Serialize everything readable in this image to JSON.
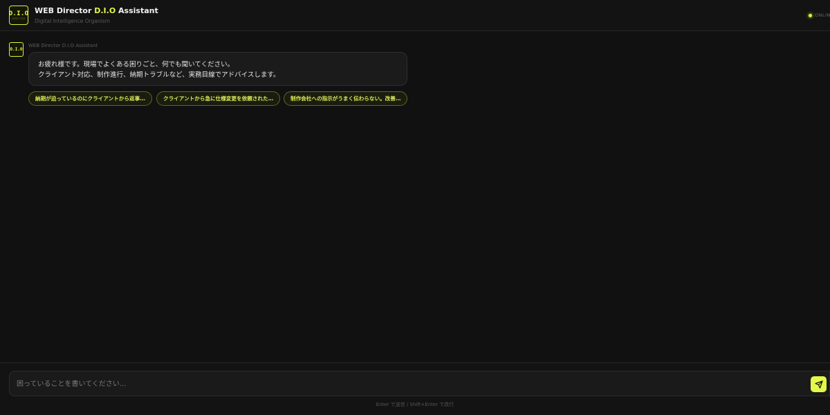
{
  "header": {
    "logo_text": "D.I.O",
    "logo_subtext": "DIRECTOR",
    "title_prefix": "WEB Director ",
    "title_accent": "D.I.O",
    "title_suffix": " Assistant",
    "subtitle": "Digital Intelligence Organism",
    "status": "ONLINE"
  },
  "colors": {
    "accent": "#e3f84a",
    "background": "#111111"
  },
  "messages": [
    {
      "avatar_text": "D.I.O",
      "sender": "WEB Director D.I.O Assistant",
      "lines": [
        "お疲れ様です。現場でよくある困りごと、何でも聞いてください。",
        "クライアント対応、制作進行、納期トラブルなど、実務目線でアドバイスします。"
      ]
    }
  ],
  "suggestions": [
    "納期が迫っているのにクライアントから返事…",
    "クライアントから急に仕様変更を依頼された…",
    "制作会社への指示がうまく伝わらない。改善…"
  ],
  "composer": {
    "placeholder": "困っていることを書いてください...",
    "send_icon": "send-icon",
    "hint": "Enter で送信 / Shift+Enter で改行"
  }
}
